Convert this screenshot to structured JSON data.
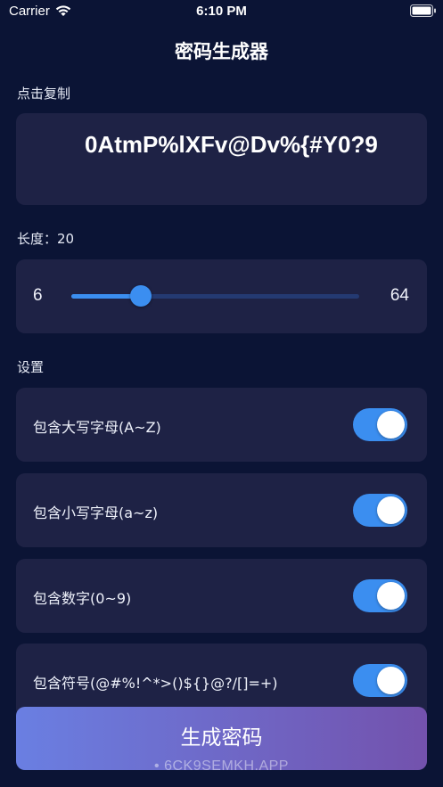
{
  "status_bar": {
    "carrier": "Carrier",
    "time": "6:10 PM",
    "icons": [
      "wifi-icon",
      "battery-icon"
    ]
  },
  "header": {
    "title": "密码生成器"
  },
  "password": {
    "label": "点击复制",
    "value": "0AtmP%lXFv@Dv%{#Y0?9"
  },
  "length": {
    "label": "长度：20",
    "value": 20,
    "min_label": "6",
    "max_label": "64",
    "min": 6,
    "max": 64
  },
  "settings": {
    "label": "设置",
    "options": [
      {
        "label": "包含大写字母(A~Z)",
        "enabled": true
      },
      {
        "label": "包含小写字母(a~z)",
        "enabled": true
      },
      {
        "label": "包含数字(0~9)",
        "enabled": true
      },
      {
        "label": "包含符号(@#%!^*>()${}@?/[]=+)",
        "enabled": true
      }
    ]
  },
  "generate_button": {
    "label": "生成密码"
  },
  "watermark": "• 6CK9SEMKH.APP",
  "colors": {
    "background": "#0b1435",
    "card": "#1e2245",
    "accent": "#3b8ef0",
    "button_gradient_start": "#6a7fe2",
    "button_gradient_end": "#7352ad"
  }
}
